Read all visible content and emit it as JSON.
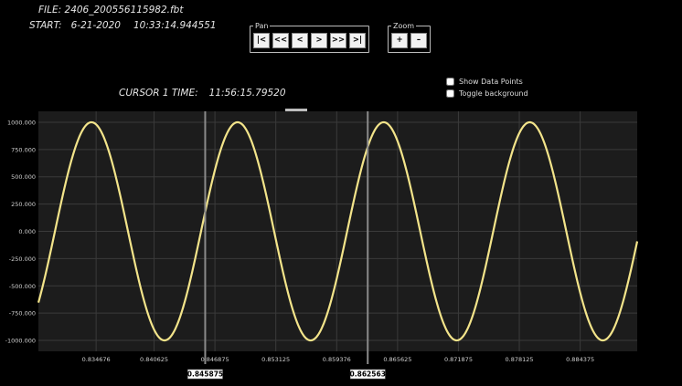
{
  "header": {
    "file_label": "FILE:",
    "file_name": "2406_200556115982.fbt",
    "start_label": "START:",
    "start_date": "6-21-2020",
    "start_time": "10:33:14.944551",
    "cursor1_label": "CURSOR 1 TIME:",
    "cursor1_time": "11:56:15.79520"
  },
  "pan": {
    "legend": "Pan",
    "buttons": [
      "|<",
      "<<",
      "<",
      ">",
      ">>",
      ">|"
    ]
  },
  "zoom": {
    "legend": "Zoom",
    "buttons": [
      "+",
      "–"
    ]
  },
  "options": {
    "show_data_points": "Show Data Points",
    "toggle_background": "Toggle background"
  },
  "colors": {
    "plot_bg": "#1c1c1c",
    "grid": "#3a3a3a",
    "trace": "#f3e48a",
    "axis_text": "#d0d0d0",
    "cursor_line": "#8a8a8a"
  },
  "chart_data": {
    "type": "line",
    "xlim": [
      0.82875,
      0.89023
    ],
    "ylim": [
      -1100,
      1100
    ],
    "yticks": [
      1000,
      750,
      500,
      250,
      0,
      -250,
      -500,
      -750,
      -1000
    ],
    "ytick_labels": [
      "1000.000",
      "750.000",
      "500.000",
      "250.000",
      "0.000",
      "-250.000",
      "-500.000",
      "-750.000",
      "-1000.000"
    ],
    "xticks": [
      0.834676,
      0.840625,
      0.846875,
      0.853125,
      0.859376,
      0.865625,
      0.871875,
      0.878125,
      0.884375
    ],
    "xtick_labels": [
      "0.834676",
      "0.840625",
      "0.846875",
      "0.853125",
      "0.859376",
      "0.865625",
      "0.871875",
      "0.878125",
      "0.884375"
    ],
    "series": [
      {
        "amplitude": 1000,
        "period": 0.015,
        "peak_x": 0.8342
      }
    ],
    "cursors": [
      {
        "x": 0.845875,
        "label": "0.845875"
      },
      {
        "x": 0.862563,
        "label": "0.862563"
      }
    ]
  }
}
